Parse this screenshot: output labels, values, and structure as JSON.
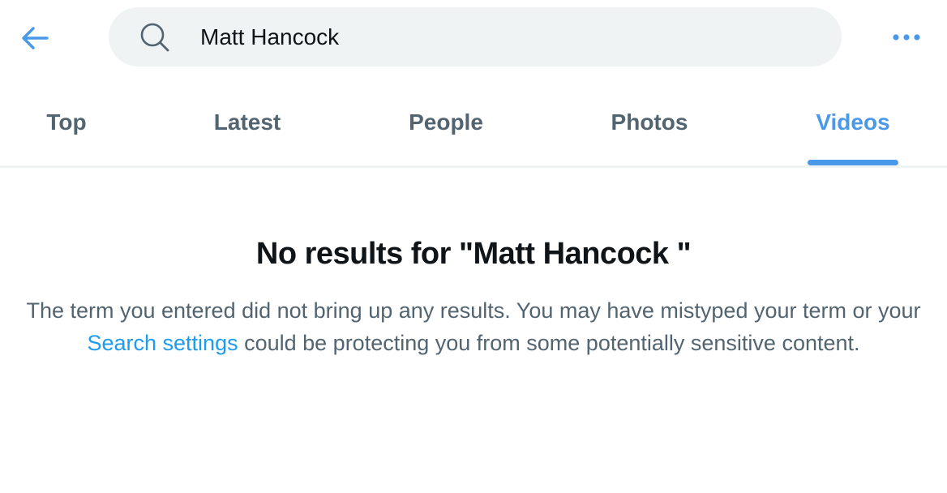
{
  "header": {
    "back_icon": "arrow-left-icon",
    "search_icon": "search-icon",
    "search_value": "Matt Hancock",
    "more_icon": "more-dots-icon"
  },
  "tabs": [
    {
      "label": "Top",
      "active": false
    },
    {
      "label": "Latest",
      "active": false
    },
    {
      "label": "People",
      "active": false
    },
    {
      "label": "Photos",
      "active": false
    },
    {
      "label": "Videos",
      "active": true
    }
  ],
  "empty_state": {
    "title": "No results for \"Matt Hancock \"",
    "body_before": "The term you entered did not bring up any results. You may have mistyped your term or your ",
    "link_text": "Search settings",
    "body_after": " could be protecting you from some potentially sensitive content."
  },
  "colors": {
    "accent": "#4a99e9",
    "link": "#1d9bf0",
    "search_bg": "#eff3f4",
    "muted_text": "#536471",
    "primary_text": "#0f1419"
  }
}
